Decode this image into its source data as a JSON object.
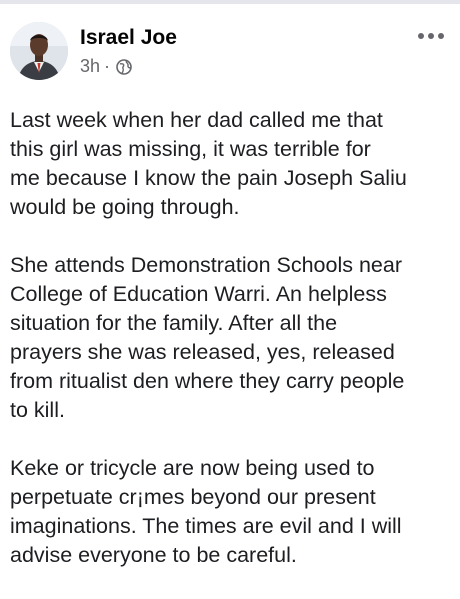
{
  "post": {
    "author": "Israel Joe",
    "time": "3h",
    "separator": "·",
    "audience_icon": "globe-icon",
    "more_icon": "more-options-icon",
    "paragraphs": [
      "Last week when her dad called me that\nthis girl was missing, it was terrible for\nme because I know the pain Joseph Saliu\nwould be going through.",
      "She attends Demonstration Schools near\nCollege of Education Warri. An helpless\nsituation for the family. After all the\nprayers she was released, yes, released\nfrom ritualist den where they carry people\nto kill.",
      "Keke or tricycle are now being used to\nperpetuate cr¡mes beyond our present\nimaginations. The times are evil and I will\nadvise everyone to be careful."
    ]
  },
  "colors": {
    "meta_text": "#65676b",
    "body_text": "#1c1e21",
    "divider": "#e4e6eb"
  }
}
